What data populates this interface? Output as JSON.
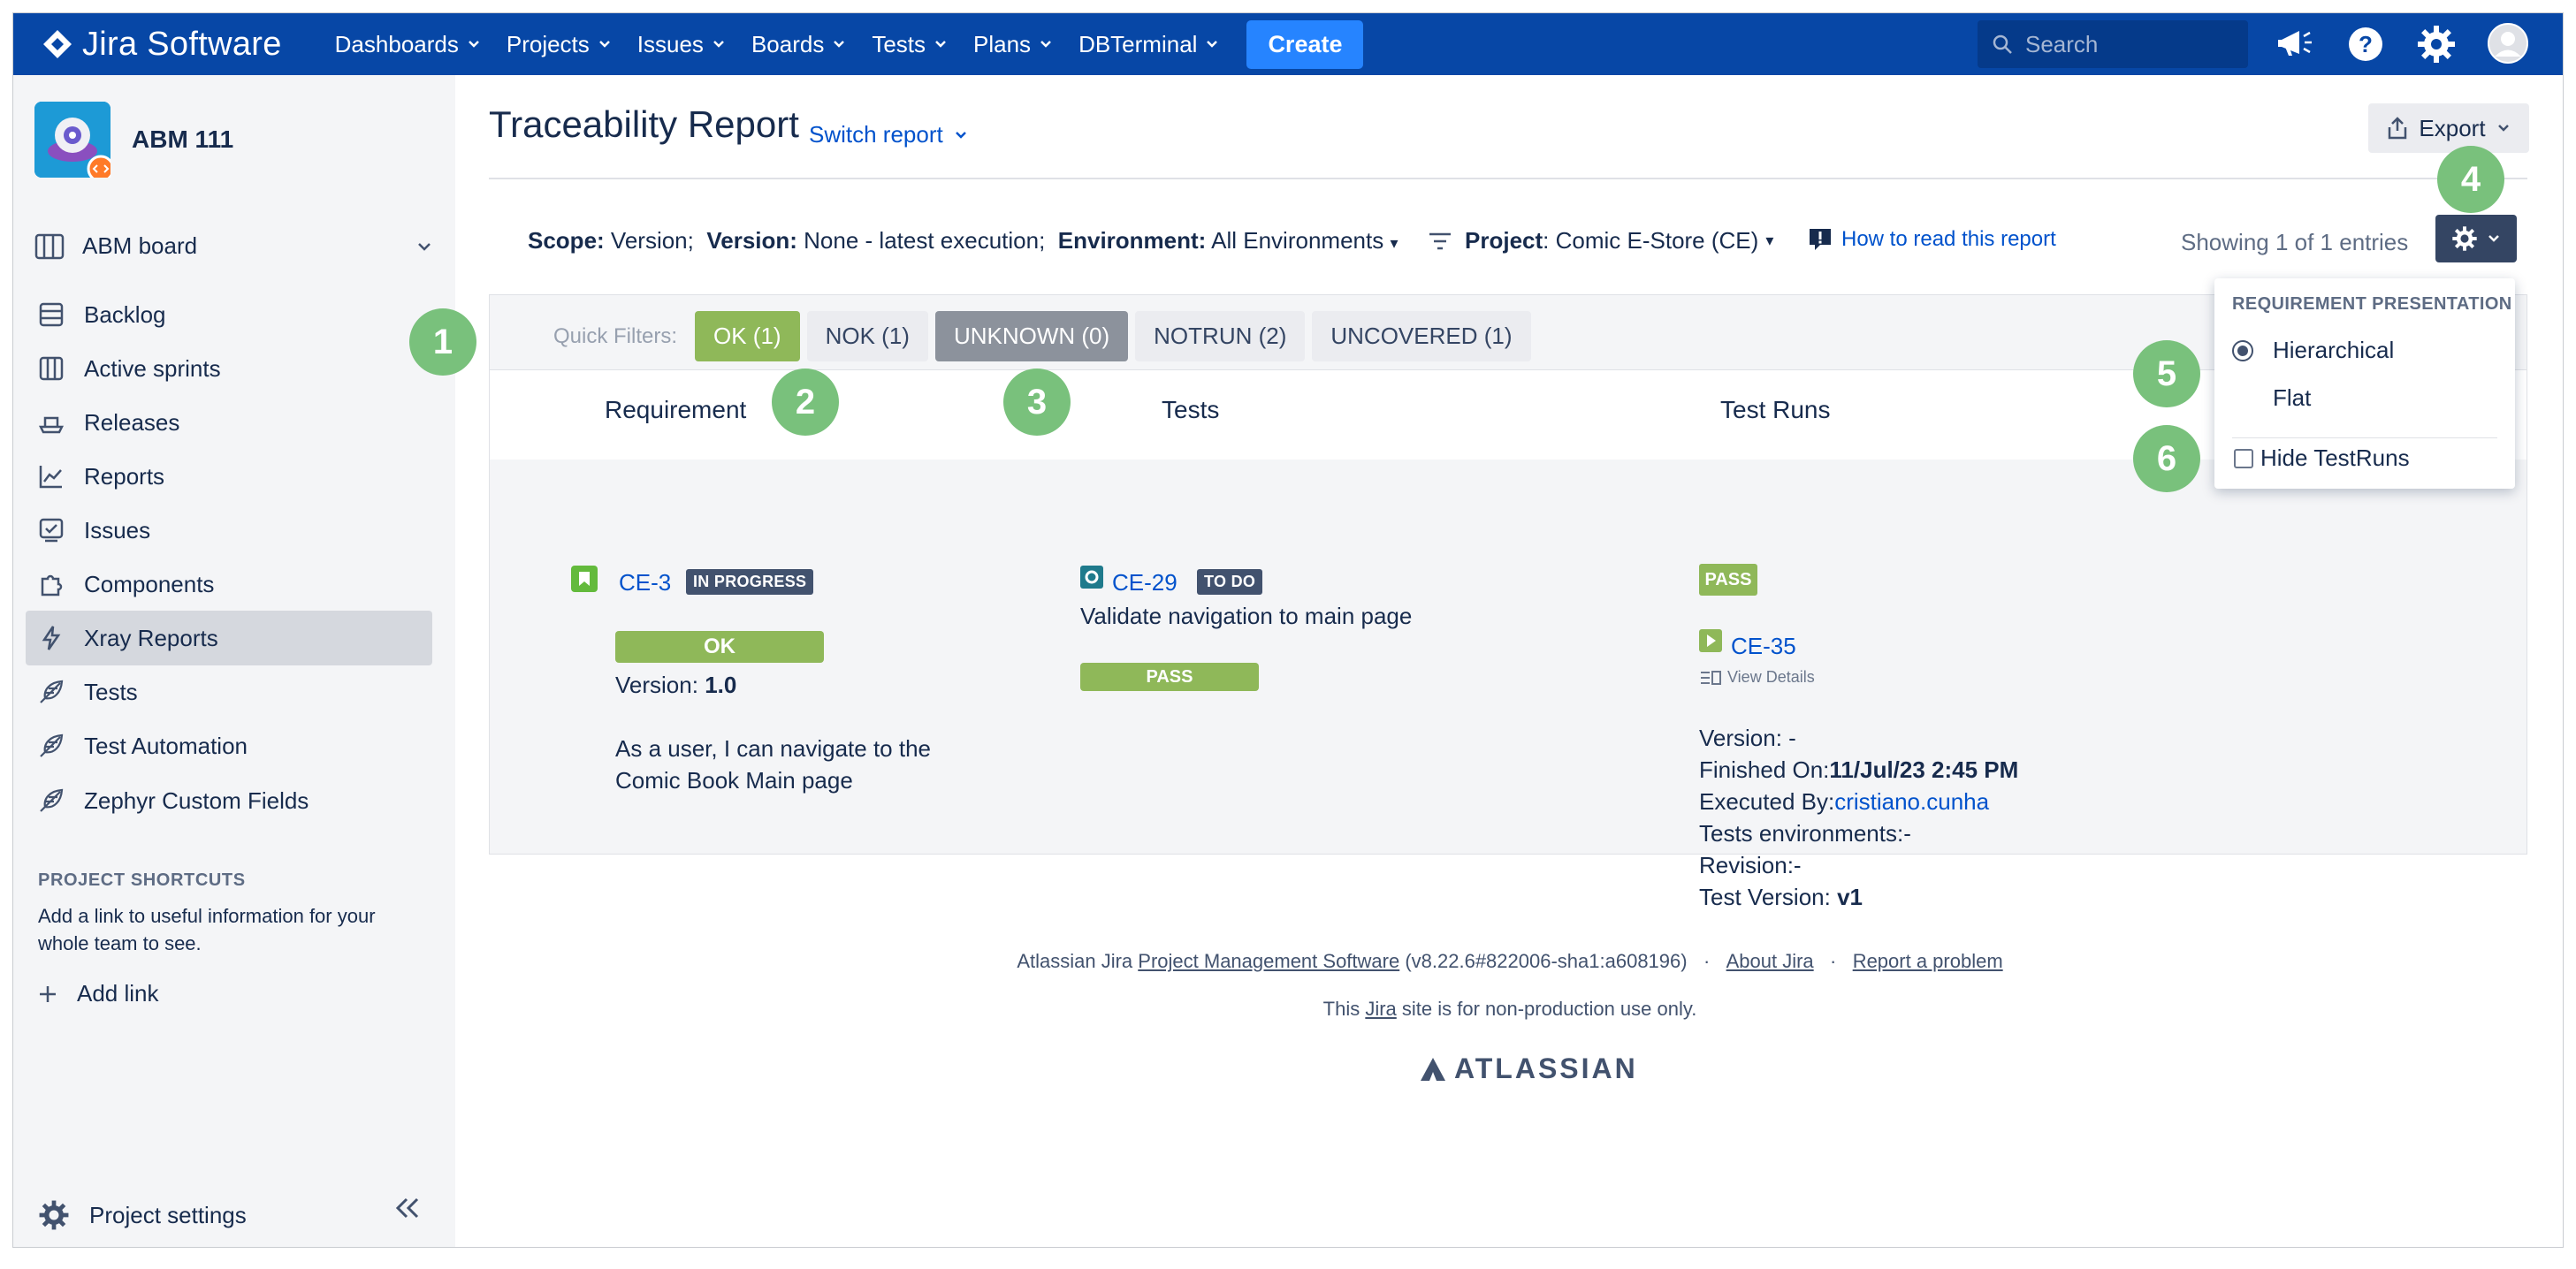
{
  "topnav": {
    "brand": "Jira Software",
    "items": [
      "Dashboards",
      "Projects",
      "Issues",
      "Boards",
      "Tests",
      "Plans",
      "DBTerminal"
    ],
    "create_label": "Create",
    "search_placeholder": "Search"
  },
  "sidebar": {
    "project_name": "ABM 111",
    "board_label": "ABM board",
    "items": [
      {
        "label": "Backlog",
        "icon": "backlog-icon"
      },
      {
        "label": "Active sprints",
        "icon": "board-icon"
      },
      {
        "label": "Releases",
        "icon": "ship-icon"
      },
      {
        "label": "Reports",
        "icon": "chart-icon"
      },
      {
        "label": "Issues",
        "icon": "issues-icon"
      },
      {
        "label": "Components",
        "icon": "puzzle-icon"
      },
      {
        "label": "Xray Reports",
        "icon": "bolt-icon",
        "active": true
      },
      {
        "label": "Tests",
        "icon": "feather-icon"
      },
      {
        "label": "Test Automation",
        "icon": "feather-icon"
      },
      {
        "label": "Zephyr Custom Fields",
        "icon": "feather-icon"
      }
    ],
    "shortcuts_title": "PROJECT SHORTCUTS",
    "shortcuts_text": "Add a link to useful information for your whole team to see.",
    "add_link": "Add link",
    "project_settings": "Project settings"
  },
  "report": {
    "title": "Traceability Report",
    "switch_report": "Switch report",
    "export_label": "Export",
    "scope_label": "Scope:",
    "scope_value": "Version;",
    "version_label": "Version:",
    "version_value": "None - latest execution;",
    "environment_label": "Environment:",
    "environment_value": "All Environments",
    "project_label": "Project",
    "project_value": ": Comic E-Store (CE)",
    "how_to_read": "How to read this report",
    "showing": "Showing 1 of 1 entries",
    "quick_filters_label": "Quick Filters:",
    "quick_filters": [
      "OK (1)",
      "NOK (1)",
      "UNKNOWN (0)",
      "NOTRUN (2)",
      "UNCOVERED (1)"
    ],
    "columns": [
      "Requirement",
      "Tests",
      "Test Runs"
    ]
  },
  "row": {
    "requirement": {
      "key": "CE-3",
      "status": "IN PROGRESS",
      "result": "OK",
      "version_label": "Version:",
      "version_value": "1.0",
      "summary_line1": "As a user, I can navigate to the",
      "summary_line2": "Comic Book Main page"
    },
    "test": {
      "key": "CE-29",
      "status": "TO DO",
      "summary": "Validate navigation to main page",
      "result": "PASS"
    },
    "test_run": {
      "result": "PASS",
      "key": "CE-35",
      "view_details": "View Details",
      "version": "Version: -",
      "finished_label": "Finished On:",
      "finished_value": "11/Jul/23 2:45 PM",
      "executed_label": "Executed By:",
      "executed_value": "cristiano.cunha",
      "tests_env": "Tests environments:-",
      "revision": "Revision:-",
      "test_version_label": "Test Version:",
      "test_version_value": "v1"
    }
  },
  "dropdown": {
    "title": "REQUIREMENT PRESENTATION",
    "options": [
      "Hierarchical",
      "Flat"
    ],
    "selected": "Hierarchical",
    "hide_testruns": "Hide TestRuns"
  },
  "badges": [
    "1",
    "2",
    "3",
    "4",
    "5",
    "6"
  ],
  "footer": {
    "prefix": "Atlassian Jira ",
    "pms_link": "Project Management Software",
    "version": " (v8.22.6#822006-sha1:a608196)",
    "sep": "·",
    "about": "About Jira",
    "report_problem": "Report a problem",
    "nonprod_prefix": "This ",
    "nonprod_link": "Jira",
    "nonprod_suffix": " site is for non-production use only.",
    "atlassian": "ATLASSIAN"
  },
  "colors": {
    "nav_bg": "#0747a6",
    "create": "#2684ff",
    "ok_green": "#8fb859",
    "badge_green": "#79c17c",
    "link": "#0052cc",
    "dark_lozenge": "#42526e"
  }
}
